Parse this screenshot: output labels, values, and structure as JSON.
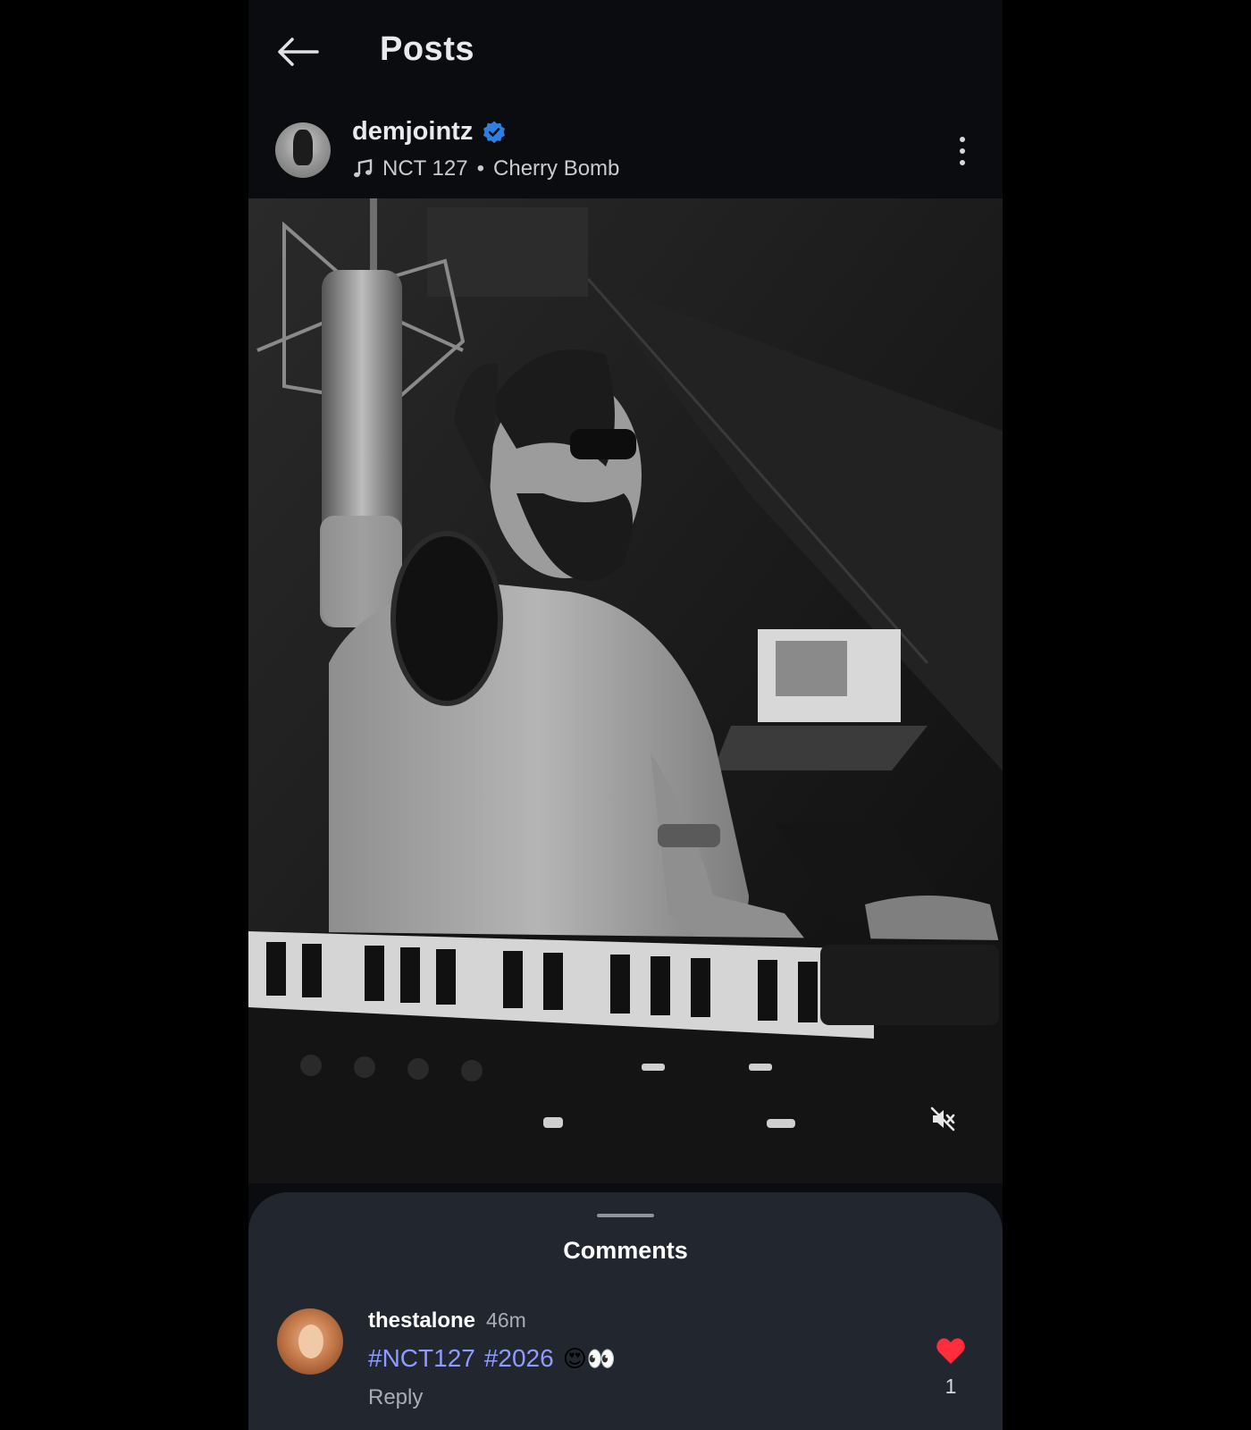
{
  "header": {
    "title": "Posts",
    "back_icon": "arrow-left-icon"
  },
  "post": {
    "username": "demjointz",
    "verified": true,
    "music": {
      "artist": "NCT 127",
      "separator": "•",
      "song": "Cherry Bomb"
    },
    "more_icon": "more-vertical-icon",
    "media_icon": "mute-icon"
  },
  "comments": {
    "title": "Comments",
    "items": [
      {
        "username": "thestalone",
        "time": "46m",
        "hashtags": [
          "#NCT127",
          "#2026"
        ],
        "emojis": "😍👀",
        "reply_label": "Reply",
        "like_count": "1",
        "liked": true
      }
    ]
  },
  "colors": {
    "background": "#0b0c0f",
    "sheet": "#22262e",
    "hashtag": "#8e9bff",
    "verified": "#2f7fe0",
    "like": "#ff2d3d"
  }
}
